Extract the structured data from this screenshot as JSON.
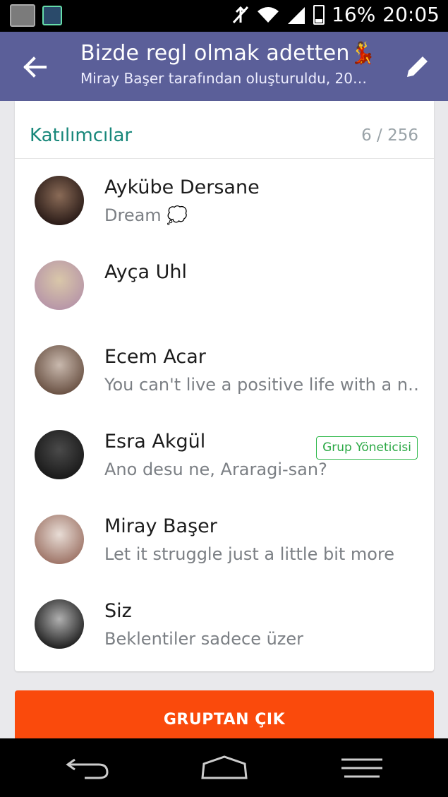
{
  "status_bar": {
    "battery": "16%",
    "time": "20:05",
    "icons": [
      "operator-app-icon",
      "activity-app-icon",
      "mute-icon",
      "wifi-icon",
      "signal-icon",
      "battery-icon"
    ]
  },
  "app_bar": {
    "title": "Bizde regl olmak adetten💃",
    "subtitle": "Miray Başer tarafından oluşturuldu, 20…",
    "background": "#5b5f99"
  },
  "participants": {
    "header_label": "Katılımcılar",
    "count": "6 / 256",
    "members": [
      {
        "name": "Aykübe Dersane",
        "status": "Dream 💭",
        "badge": "",
        "avatar_colors": [
          "#2b1c18",
          "#8a6b57"
        ]
      },
      {
        "name": "Ayça Uhl",
        "status": "",
        "badge": "",
        "avatar_colors": [
          "#b897a8",
          "#d9c7a9"
        ]
      },
      {
        "name": "Ecem Acar",
        "status": "You can't live a positive life with a n…👍",
        "badge": "",
        "avatar_colors": [
          "#6c5446",
          "#c9b9ae"
        ]
      },
      {
        "name": "Esra Akgül",
        "status": "Ano desu ne, Araragi-san?",
        "badge": "Grup Yöneticisi",
        "avatar_colors": [
          "#1a1a1a",
          "#4a4a4a"
        ]
      },
      {
        "name": "Miray Başer",
        "status": "Let it struggle just a little bit more",
        "badge": "",
        "avatar_colors": [
          "#a0776a",
          "#e8ddd6"
        ]
      },
      {
        "name": "Siz",
        "status": "Beklentiler sadece üzer",
        "badge": "",
        "avatar_colors": [
          "#222222",
          "#b0b0b0"
        ]
      }
    ]
  },
  "leave_button": {
    "label": "GRUPTAN ÇIK",
    "color": "#fa4a0c"
  },
  "colors": {
    "accent_green": "#17877a",
    "admin_green": "#2eb84a"
  }
}
